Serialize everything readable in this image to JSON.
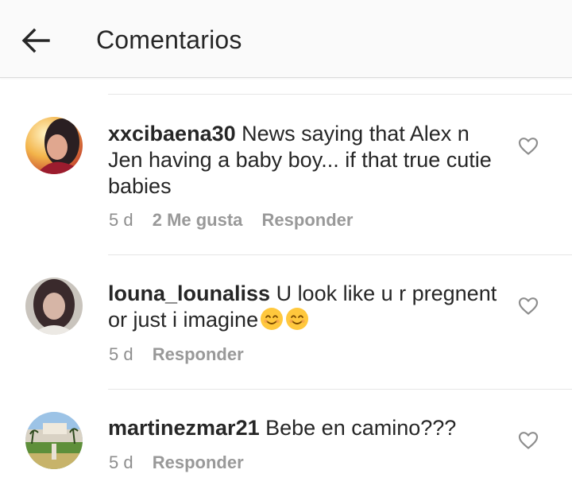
{
  "header": {
    "back_icon": "arrow-left-icon",
    "title": "Comentarios"
  },
  "comments": [
    {
      "username": "xxcibaena30",
      "text": "News saying that Alex n Jen having a baby boy... if that true cutie babies",
      "time": "5 d",
      "likes": "2 Me gusta",
      "reply": "Responder",
      "like_icon": "heart-outline-icon"
    },
    {
      "username": "louna_lounaliss",
      "text": "U look like u r pregnent or just i imagine",
      "emojis": "😊😊",
      "time": "5 d",
      "reply": "Responder",
      "like_icon": "heart-outline-icon"
    },
    {
      "username": "martinezmar21",
      "text": "Bebe en camino???",
      "time": "5 d",
      "reply": "Responder",
      "like_icon": "heart-outline-icon"
    }
  ],
  "colors": {
    "text": "#262626",
    "secondary": "#8e8e8e",
    "divider": "#e6e6e6",
    "header_bg": "#fafafa"
  }
}
